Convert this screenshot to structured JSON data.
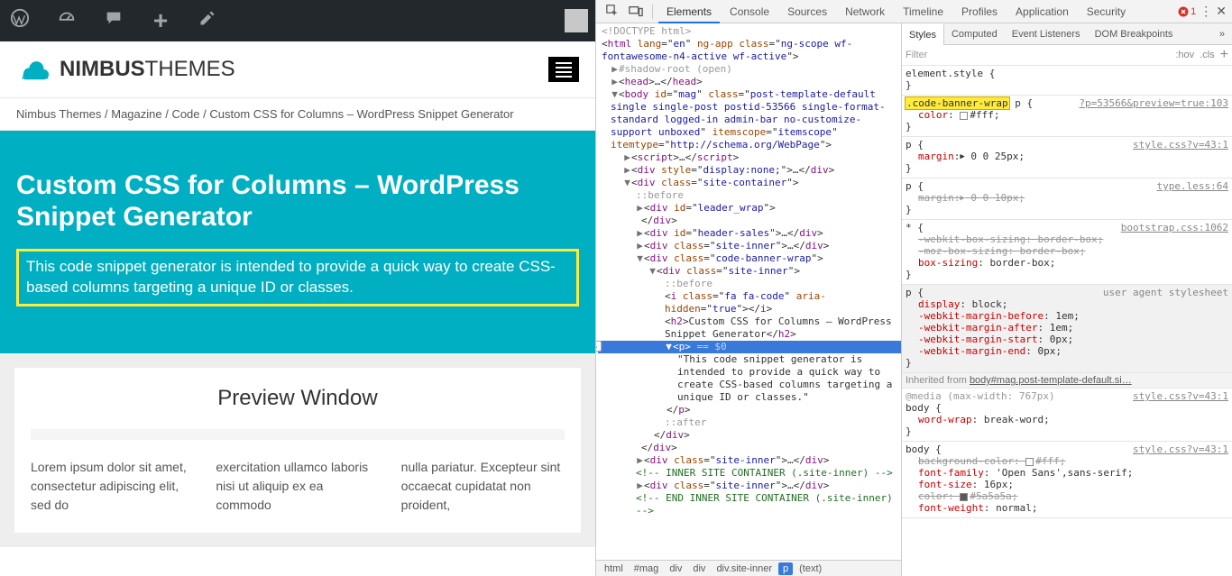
{
  "devtools": {
    "tabs": [
      "Elements",
      "Console",
      "Sources",
      "Network",
      "Timeline",
      "Profiles",
      "Application",
      "Security"
    ],
    "active_tab": "Elements",
    "errors": 1,
    "styles_tabs": [
      "Styles",
      "Computed",
      "Event Listeners",
      "DOM Breakpoints"
    ],
    "styles_active": "Styles",
    "filter_placeholder": "Filter",
    "hov": ":hov",
    "cls": ".cls",
    "crumb": [
      "html",
      "#mag",
      "div",
      "div",
      "div.site-inner",
      "p",
      "(text)"
    ],
    "crumb_selected_idx": 5,
    "tree": {
      "doctype": "<!DOCTYPE html>",
      "html_open": "<html lang=\"en\" ng-app class=\"ng-scope wf-fontawesome-n4-active wf-active\">",
      "shadow": "#shadow-root (open)",
      "head": "<head>…</head>",
      "body_open": "<body id=\"mag\" class=\"post-template-default single single-post postid-53566 single-format-standard logged-in admin-bar no-customize-support unboxed\" itemscope=\"itemscope\" itemtype=\"http://schema.org/WebPage\">",
      "script": "<script>…</script>",
      "div_display_none": "<div style=\"display:none;\">…</div>",
      "site_container_open": "<div class=\"site-container\">",
      "before": "::before",
      "leader_wrap": "<div id=\"leader_wrap\">",
      "leader_wrap_close": "</div>",
      "header_sales": "<div id=\"header-sales\">…</div>",
      "site_inner1": "<div class=\"site-inner\">…</div>",
      "code_banner_wrap_open": "<div class=\"code-banner-wrap\">",
      "site_inner_open": "<div class=\"site-inner\">",
      "i_code": "<i class=\"fa fa-code\" aria-hidden=\"true\"></i>",
      "h2_text_open": "<h2>",
      "h2_text": "Custom CSS for Columns – WordPress Snippet Generator",
      "h2_close": "</h2>",
      "p_selected": "<p> == $0",
      "p_text": "\"This code snippet generator is intended to provide a quick way to create CSS-based columns targeting a unique ID or classes.\"",
      "p_close": "</p>",
      "after": "::after",
      "div_close": "</div>",
      "site_inner2": "<div class=\"site-inner\">…</div>",
      "comment1": "<!-- INNER SITE CONTAINER (.site-inner) -->",
      "site_inner3": "<div class=\"site-inner\">…</div>",
      "comment2": "<!-- END INNER SITE CONTAINER (.site-inner) -->"
    },
    "styles": {
      "element_style_sel": "element.style {",
      "close": "}",
      "code_banner_sel_left": ".code-banner-wrap",
      "code_banner_sel_right": " p {",
      "code_banner_src": "?p=53566&preview=true:103",
      "color_prop": "color",
      "color_val": "#fff;",
      "p_margin_sel": "p {",
      "p_margin_src": "style.css?v=43:1",
      "margin_prop": "margin",
      "margin_val": "0 0 25px;",
      "p_margin2_src": "type.less:64",
      "p_margin2_sel": "p {",
      "margin2_val": "0 0 10px;",
      "star_sel": "* {",
      "star_src": "bootstrap.css:1062",
      "wbs": "-webkit-box-sizing",
      "mbs": "-moz-box-sizing",
      "bs": "box-sizing",
      "bb": "border-box;",
      "ua_sel": "p {",
      "ua_src": "user agent stylesheet",
      "disp": "display",
      "block": "block;",
      "wmb": "-webkit-margin-before",
      "wma": "-webkit-margin-after",
      "wms": "-webkit-margin-start",
      "wme": "-webkit-margin-end",
      "em1": "1em;",
      "px0": "0px;",
      "inherited": "Inherited from",
      "inherited_from": "body#mag.post-template-default.si…",
      "media": "@media (max-width: 767px)",
      "body_sel": "body {",
      "body_src": "style.css?v=43:1",
      "ww": "word-wrap",
      "bw": "break-word;",
      "bg": "background-color",
      "bg_val": "#fff;",
      "ff": "font-family",
      "ff_val": "'Open Sans',sans-serif;",
      "fs": "font-size",
      "fs_val": "16px;",
      "color2": "color",
      "color2_val": "#5a5a5a;",
      "fw": "font-weight",
      "fw_val": "normal;"
    }
  },
  "page": {
    "logo_bold": "NIMBUS",
    "logo_light": "THEMES",
    "breadcrumb": "Nimbus Themes / Magazine / Code / Custom CSS for Columns – WordPress Snippet Generator",
    "title": "Custom CSS for Columns – WordPress Snippet Generator",
    "subtitle": "This code snippet generator is intended to provide a quick way to create CSS-based columns targeting a unique ID or classes.",
    "preview_title": "Preview Window",
    "lorem1": "Lorem ipsum dolor sit amet, consectetur adipiscing elit, sed do",
    "lorem2": "exercitation ullamco laboris nisi ut aliquip ex ea commodo",
    "lorem3": "nulla pariatur. Excepteur sint occaecat cupidatat non proident,"
  }
}
